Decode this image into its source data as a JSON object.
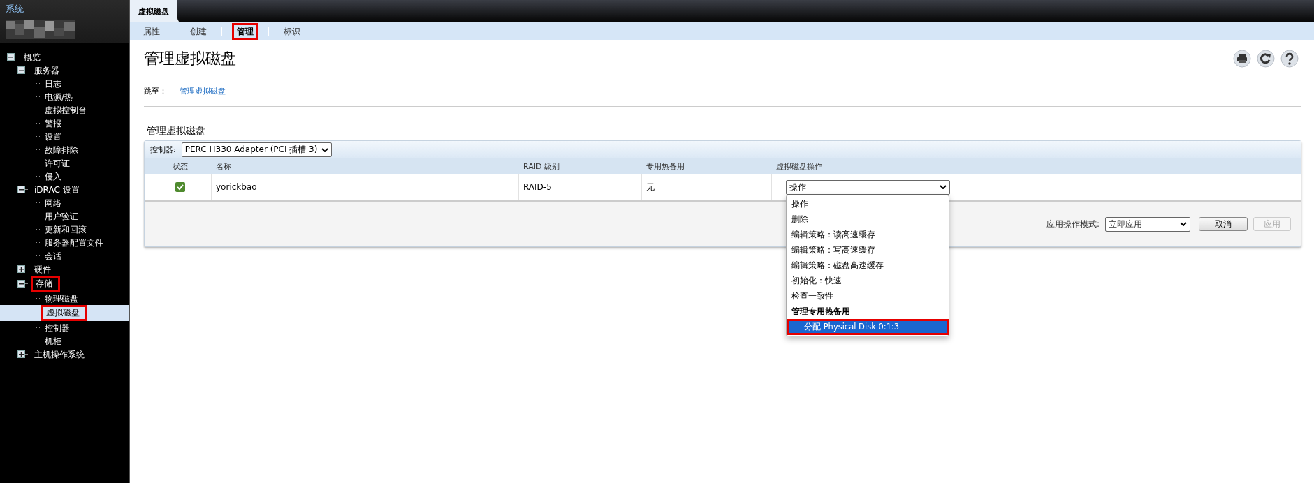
{
  "sidebar": {
    "title": "系统",
    "tree": [
      {
        "label": "概览",
        "expanded": true,
        "selected": false,
        "highlighted": false,
        "children": [
          {
            "label": "服务器",
            "expanded": true,
            "selected": false,
            "highlighted": false,
            "children": [
              {
                "label": "日志",
                "selected": false,
                "highlighted": false
              },
              {
                "label": "电源/热",
                "selected": false,
                "highlighted": false
              },
              {
                "label": "虚拟控制台",
                "selected": false,
                "highlighted": false
              },
              {
                "label": "警报",
                "selected": false,
                "highlighted": false
              },
              {
                "label": "设置",
                "selected": false,
                "highlighted": false
              },
              {
                "label": "故障排除",
                "selected": false,
                "highlighted": false
              },
              {
                "label": "许可证",
                "selected": false,
                "highlighted": false
              },
              {
                "label": "侵入",
                "selected": false,
                "highlighted": false
              }
            ]
          },
          {
            "label": "iDRAC 设置",
            "expanded": true,
            "selected": false,
            "highlighted": false,
            "children": [
              {
                "label": "网络",
                "selected": false,
                "highlighted": false
              },
              {
                "label": "用户验证",
                "selected": false,
                "highlighted": false
              },
              {
                "label": "更新和回滚",
                "selected": false,
                "highlighted": false
              },
              {
                "label": "服务器配置文件",
                "selected": false,
                "highlighted": false
              },
              {
                "label": "会话",
                "selected": false,
                "highlighted": false
              }
            ]
          },
          {
            "label": "硬件",
            "expanded": false,
            "selected": false,
            "highlighted": false
          },
          {
            "label": "存储",
            "expanded": true,
            "selected": false,
            "highlighted": true,
            "children": [
              {
                "label": "物理磁盘",
                "selected": false,
                "highlighted": false
              },
              {
                "label": "虚拟磁盘",
                "selected": true,
                "highlighted": true
              },
              {
                "label": "控制器",
                "selected": false,
                "highlighted": false
              },
              {
                "label": "机柜",
                "selected": false,
                "highlighted": false
              }
            ]
          },
          {
            "label": "主机操作系统",
            "expanded": false,
            "selected": false,
            "highlighted": false
          }
        ]
      }
    ]
  },
  "tab": {
    "label": "虚拟磁盘"
  },
  "subtabs": [
    {
      "label": "属性",
      "selected": false,
      "highlighted": false
    },
    {
      "label": "创建",
      "selected": false,
      "highlighted": false
    },
    {
      "label": "管理",
      "selected": true,
      "highlighted": true
    },
    {
      "label": "标识",
      "selected": false,
      "highlighted": false
    }
  ],
  "page_title": "管理虚拟磁盘",
  "jump": {
    "label": "跳至：",
    "link": "管理虚拟磁盘"
  },
  "section_title": "管理虚拟磁盘",
  "controller": {
    "label": "控制器:",
    "value": "PERC H330 Adapter (PCI 插槽 3)"
  },
  "table": {
    "columns": [
      "状态",
      "名称",
      "RAID 级别",
      "专用热备用",
      "虚拟磁盘操作"
    ],
    "rows": [
      {
        "status_ok": true,
        "name": "yorickbao",
        "raid": "RAID-5",
        "hot_spare": "无",
        "action": "操作"
      }
    ]
  },
  "apply_mode": {
    "label": "应用操作模式:",
    "value": "立即应用"
  },
  "buttons": [
    {
      "label": "取消",
      "disabled": false
    },
    {
      "label": "应用",
      "disabled": true
    }
  ],
  "dropdown": [
    {
      "kind": "option",
      "label": "操作",
      "selected": false,
      "highlighted": false
    },
    {
      "kind": "option",
      "label": "删除",
      "selected": false,
      "highlighted": false
    },
    {
      "kind": "option",
      "label": "编辑策略：读高速缓存",
      "selected": false,
      "highlighted": false
    },
    {
      "kind": "option",
      "label": "编辑策略：写高速缓存",
      "selected": false,
      "highlighted": false
    },
    {
      "kind": "option",
      "label": "编辑策略：磁盘高速缓存",
      "selected": false,
      "highlighted": false
    },
    {
      "kind": "option",
      "label": "初始化：快速",
      "selected": false,
      "highlighted": false
    },
    {
      "kind": "option",
      "label": "检查一致性",
      "selected": false,
      "highlighted": false
    },
    {
      "kind": "group",
      "label": "管理专用热备用",
      "selected": false,
      "highlighted": false
    },
    {
      "kind": "suboption",
      "label": "分配 Physical Disk 0:1:3",
      "selected": true,
      "highlighted": true
    }
  ]
}
